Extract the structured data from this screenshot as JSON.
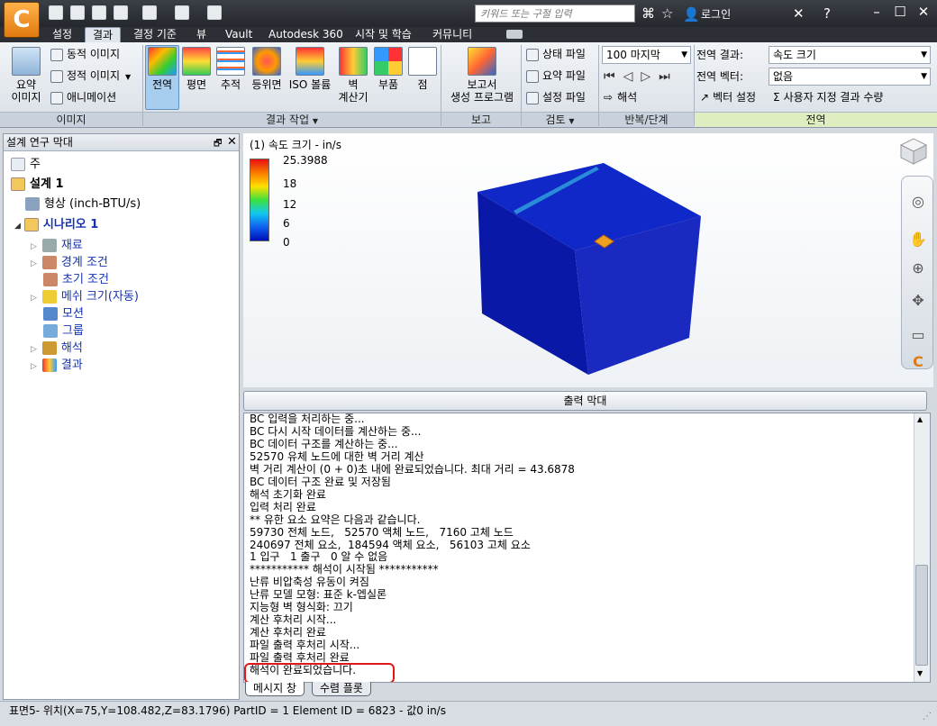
{
  "app": {
    "logo_letter": "C",
    "search_placeholder": "키워드 또는 구절 입력",
    "login": "로그인",
    "accent": "#e07a10"
  },
  "tabs": [
    "설정",
    "결과",
    "결정 기준",
    "뷰",
    "Vault",
    "Autodesk 360",
    "시작 및 학습",
    "커뮤니티"
  ],
  "ribbon": {
    "image_group": {
      "label": "이미지",
      "summary_image": "요약\n이미지",
      "dynamic_image": "동적 이미지",
      "static_image": "정적 이미지",
      "animation": "애니메이션"
    },
    "result_tasks": {
      "label": "결과 작업",
      "items": [
        "전역",
        "평면",
        "추적",
        "등위면",
        "ISO 볼륨",
        "벽\n계산기",
        "부품",
        "점"
      ]
    },
    "report": {
      "label": "보고",
      "generator": "보고서\n생성 프로그램"
    },
    "review": {
      "label": "검토",
      "status_file": "상태 파일",
      "summary_file": "요약 파일",
      "settings_file": "설정 파일"
    },
    "iteration": {
      "label": "반복/단계",
      "value": "100 마지막",
      "analysis": "해석"
    },
    "global": {
      "label": "전역",
      "result_label": "전역 결과:",
      "result_value": "속도 크기",
      "vector_label": "전역 벡터:",
      "vector_value": "없음",
      "vector_settings": "벡터 설정",
      "custom_quantity": "사용자 지정 결과 수량"
    }
  },
  "left_panel": {
    "title": "설계 연구 막대",
    "items": [
      "주",
      "설계 1",
      "형상 (inch-BTU/s)",
      "시나리오 1",
      "재료",
      "경계 조건",
      "초기 조건",
      "메쉬 크기(자동)",
      "모션",
      "그룹",
      "해석",
      "결과"
    ]
  },
  "viewport": {
    "title": "(1) 속도 크기 - in/s",
    "legend": [
      "25.3988",
      "18",
      "12",
      "6",
      "0"
    ]
  },
  "output": {
    "button": "출력 막대",
    "lines": [
      "BC 입력을 처리하는 중...",
      "BC 다시 시작 데이터를 계산하는 중...",
      "BC 데이터 구조를 계산하는 중...",
      "52570 유체 노드에 대한 벽 거리 계산",
      "벽 거리 계산이 (0 + 0)초 내에 완료되었습니다. 최대 거리 = 43.6878",
      "BC 데이터 구조 완료 및 저장됨",
      "해석 초기화 완료",
      "입력 처리 완료",
      "** 유한 요소 요약은 다음과 같습니다.",
      "59730 전체 노드,   52570 액체 노드,   7160 고체 노드",
      "240697 전체 요소,  184594 액체 요소,   56103 고체 요소",
      "1 입구   1 출구   0 알 수 없음",
      "*********** 해석이 시작됨 ***********",
      "난류 비압축성 유동이 켜짐",
      "난류 모델 모형: 표준 k-엡실론",
      "지능형 벽 형식화: 끄기",
      "계산 후처리 시작...",
      "계산 후처리 완료",
      "파일 출력 후처리 시작...",
      "파일 출력 후처리 완료",
      "해석이 완료되었습니다."
    ],
    "tabs": [
      "메시지 창",
      "수렴 플롯"
    ]
  },
  "status": "표면5- 위치(X=75,Y=108.482,Z=83.1796) PartID = 1 Element ID = 6823 - 값0  in/s"
}
